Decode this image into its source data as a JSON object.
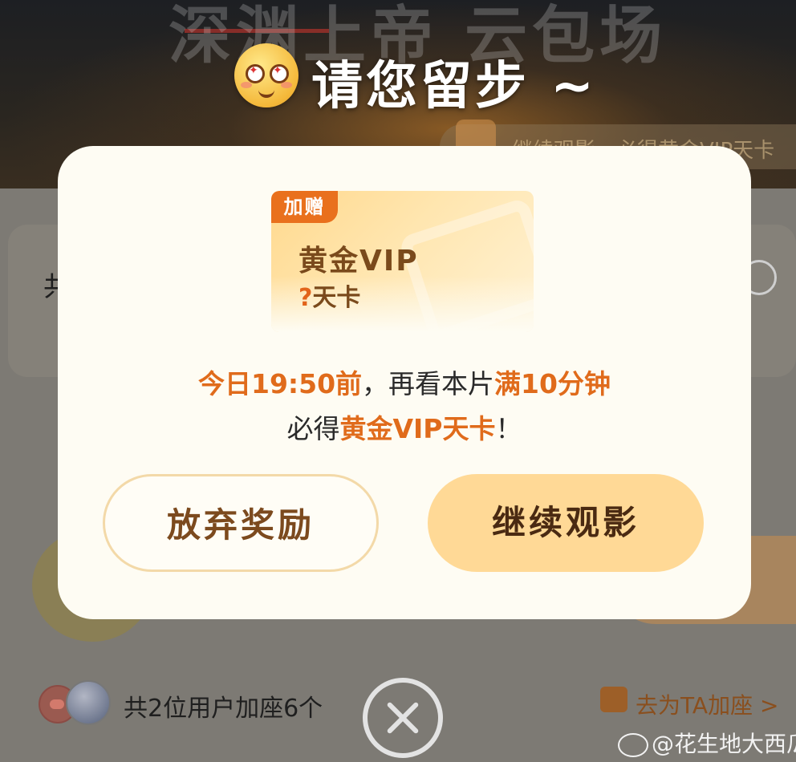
{
  "background": {
    "title": "深渊上帝 云包场",
    "banner_text": "继续观影，必得黄金VIP天卡",
    "card_prefix": "共",
    "users_text": "共2位用户加座6个",
    "seat_link": "去为TA加座 >"
  },
  "dialog": {
    "title": "请您留步 ~",
    "card": {
      "tag": "加赠",
      "name": "黄金VIP",
      "days_mark": "?",
      "days_suffix": "天卡"
    },
    "message": {
      "line1_highlight_a": "今日19:50前",
      "line1_plain": "，再看本片",
      "line1_highlight_b": "满10分钟",
      "line2_plain_a": "必得",
      "line2_highlight": "黄金VIP天卡",
      "line2_plain_b": "！"
    },
    "buttons": {
      "give_up": "放弃奖励",
      "continue": "继续观影"
    }
  },
  "watermark": "@花生地大西瓜",
  "colors": {
    "accent_orange": "#e06b1b",
    "tag_orange": "#e9701d",
    "continue_button": "#ffd996",
    "dialog_bg": "#fefcf3"
  },
  "icons": [
    "smiling-emoji-icon",
    "close-icon",
    "seat-icon",
    "weibo-icon",
    "avatar"
  ]
}
